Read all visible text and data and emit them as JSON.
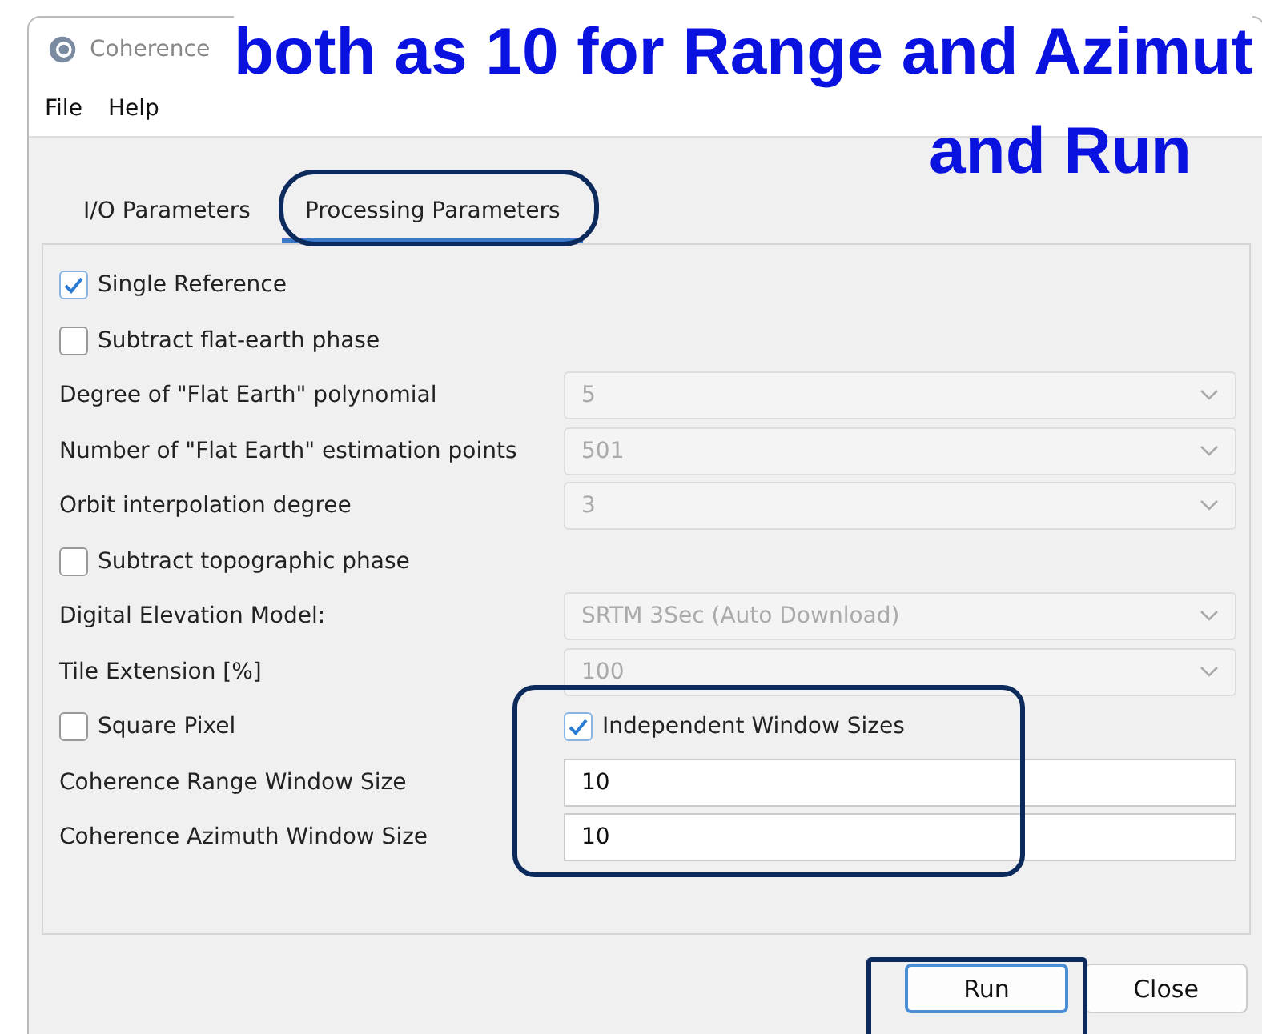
{
  "window": {
    "title": "Coherence"
  },
  "menu": [
    "File",
    "Help"
  ],
  "tabs": [
    {
      "label": "I/O Parameters",
      "selected": false
    },
    {
      "label": "Processing Parameters",
      "selected": true
    }
  ],
  "rows": [
    {
      "kind": "checkbox",
      "label": "Single Reference",
      "checked": true
    },
    {
      "kind": "checkbox",
      "label": "Subtract flat-earth phase",
      "checked": false
    },
    {
      "kind": "combo",
      "label": "Degree of \"Flat Earth\" polynomial",
      "value": "5",
      "disabled": true
    },
    {
      "kind": "combo",
      "label": "Number of \"Flat Earth\" estimation points",
      "value": "501",
      "disabled": true
    },
    {
      "kind": "combo",
      "label": "Orbit interpolation degree",
      "value": "3",
      "disabled": true
    },
    {
      "kind": "checkbox",
      "label": "Subtract topographic phase",
      "checked": false
    },
    {
      "kind": "combo",
      "label": "Digital Elevation Model:",
      "value": "SRTM 3Sec (Auto Download)",
      "disabled": true
    },
    {
      "kind": "combo",
      "label": "Tile Extension [%]",
      "value": "100",
      "disabled": true
    },
    {
      "kind": "checkpair",
      "left": {
        "label": "Square Pixel",
        "checked": false
      },
      "right": {
        "label": "Independent Window Sizes",
        "checked": true
      }
    },
    {
      "kind": "field",
      "label": "Coherence Range Window Size",
      "value": "10"
    },
    {
      "kind": "field",
      "label": "Coherence Azimuth Window Size",
      "value": "10"
    }
  ],
  "buttons": [
    {
      "label": "Run",
      "focused": true
    },
    {
      "label": "Close",
      "focused": false
    }
  ],
  "annotation": {
    "lines": [
      "both as 10 for Range and Azimut",
      "and Run"
    ]
  }
}
